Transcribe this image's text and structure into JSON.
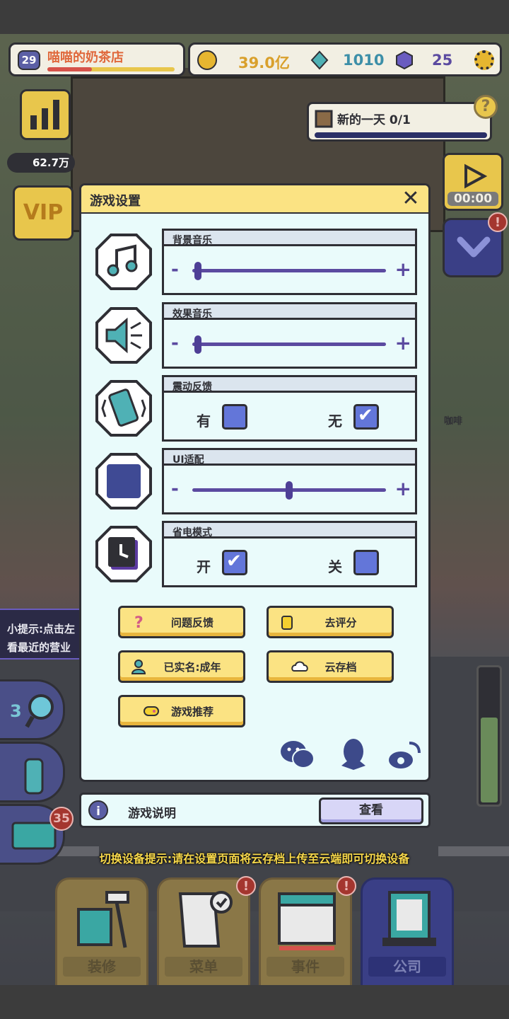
{
  "hud": {
    "level": "29",
    "shop_name": "喵喵的奶茶店",
    "shop_progress": 0.35,
    "coins": "39.0亿",
    "gems": "1010",
    "crystals": "25",
    "income": "62.7万",
    "vip": "VIP",
    "timer": "00:00"
  },
  "task": {
    "label": "新的一天 0/1"
  },
  "dialog": {
    "title": "游戏设置",
    "rows": [
      {
        "label": "背景音乐",
        "type": "slider",
        "value": 0.01
      },
      {
        "label": "效果音乐",
        "type": "slider",
        "value": 0.01
      },
      {
        "label": "震动反馈",
        "type": "toggle",
        "options": [
          "有",
          "无"
        ],
        "selected": "无"
      },
      {
        "label": "UI适配",
        "type": "slider",
        "value": 0.5
      },
      {
        "label": "省电模式",
        "type": "toggle",
        "options": [
          "开",
          "关"
        ],
        "selected": "开"
      }
    ],
    "slider_minus": "-",
    "slider_plus": "+",
    "buttons": {
      "feedback": "问题反馈",
      "rate": "去评分",
      "realname": "已实名:成年",
      "cloud_save": "云存档",
      "recommend": "游戏推荐"
    }
  },
  "info": {
    "label": "游戏说明",
    "view_button": "查看",
    "icon_glyph": "i"
  },
  "tip": "切换设备提示:请在设置页面将云存档上传至云端即可切换设备",
  "nav": [
    {
      "label": "装修",
      "alert": false
    },
    {
      "label": "菜单",
      "alert": true
    },
    {
      "label": "事件",
      "alert": true
    },
    {
      "label": "公司",
      "alert": false,
      "active": true
    }
  ],
  "alert_glyph": "!",
  "side": {
    "hint": "小提示:点击左",
    "hint2": "看最近的营业",
    "badge_count": "35",
    "magnifier_count": "3",
    "bubble_cafe": "咖啡"
  },
  "colors": {
    "accent_yellow": "#fbe383",
    "accent_purple": "#5b4aa0",
    "checkbox_blue": "#6376d9",
    "dialog_bg": "#e9fbfb"
  }
}
